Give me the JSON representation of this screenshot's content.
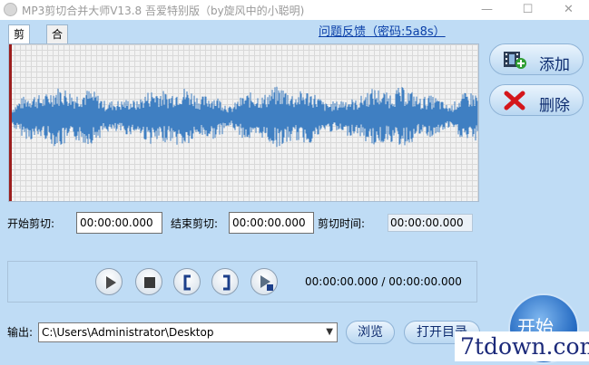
{
  "window": {
    "title": "MP3剪切合并大师V13.8 吾爱特别版（by旋风中的小聪明)",
    "min_glyph": "—",
    "max_glyph": "☐",
    "close_glyph": "✕"
  },
  "tabs": [
    {
      "label": "剪切",
      "active": true
    },
    {
      "label": "合并",
      "active": false
    }
  ],
  "feedback_link": "问题反馈（密码:5a8s）",
  "side_buttons": {
    "add": {
      "label": "添加",
      "icon": "film-add-icon"
    },
    "delete": {
      "label": "删除",
      "icon": "red-x-icon"
    }
  },
  "cut": {
    "start_label": "开始剪切:",
    "start_value": "00:00:00.000",
    "end_label": "结束剪切:",
    "end_value": "00:00:00.000",
    "duration_label": "剪切时间:",
    "duration_value": "00:00:00.000"
  },
  "player": {
    "buttons": [
      "play-icon",
      "stop-icon",
      "mark-start-icon",
      "mark-end-icon",
      "play-selection-icon"
    ],
    "position": "00:00:00.000 / 00:00:00.000"
  },
  "output": {
    "label": "输出:",
    "path": "C:\\Users\\Administrator\\Desktop",
    "browse_label": "浏览",
    "open_dir_label": "打开目录"
  },
  "start_button": "开始",
  "watermark": "7tdown.com",
  "colors": {
    "background": "#bfdcf5",
    "waveform": "#3f7fc2",
    "cursor": "#9c1d1d",
    "link": "#0a3fa8"
  }
}
